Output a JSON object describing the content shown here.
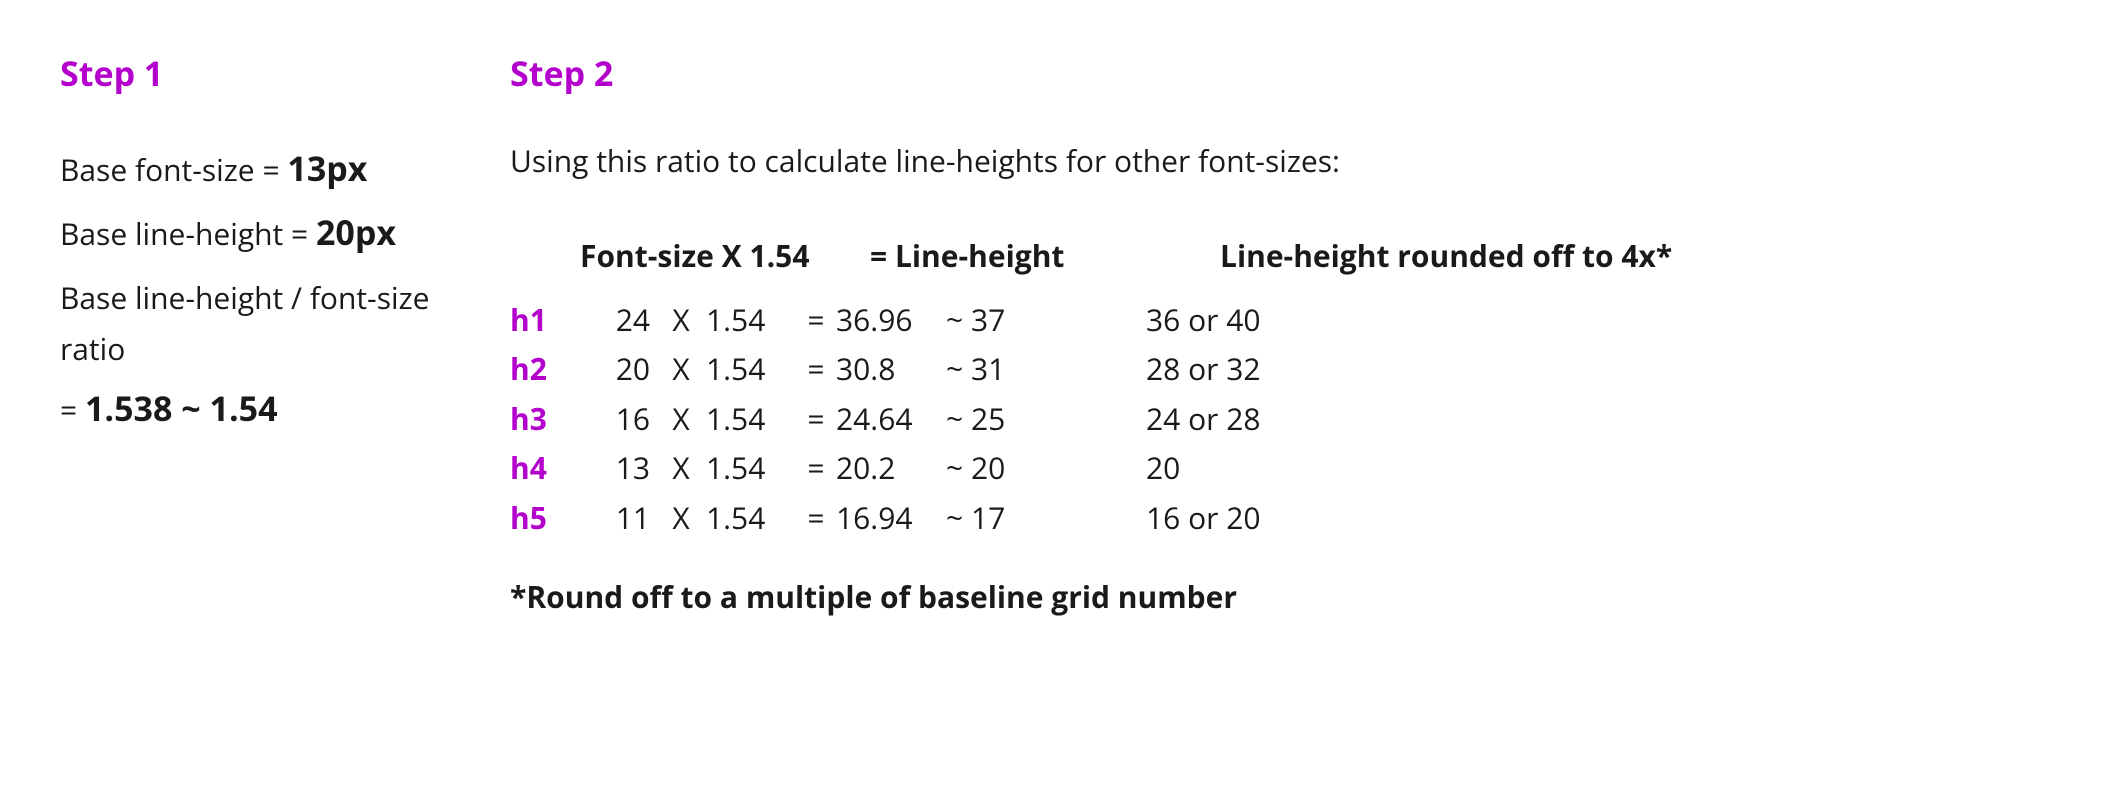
{
  "step1": {
    "title": "Step 1",
    "base_font_label": "Base font-size = ",
    "base_font_value": "13px",
    "base_lh_label": "Base line-height = ",
    "base_lh_value": "20px",
    "ratio_label": "Base line-height / font-size ratio",
    "ratio_value_prefix": "= ",
    "ratio_value": "1.538 ~ 1.54"
  },
  "step2": {
    "title": "Step 2",
    "description": "Using this ratio to calculate line-heights for other font-sizes:",
    "header": {
      "fontsize": "Font-size   X  1.54",
      "lineheight": "= Line-height",
      "rounded": "Line-height rounded off to 4x*"
    },
    "multiplier_sym": "X",
    "multiplier_val": "1.54",
    "equals": "=",
    "rows": [
      {
        "tag": "h1",
        "fs": "24",
        "product": "36.96",
        "approx": "~ 37",
        "rounded": "36 or 40"
      },
      {
        "tag": "h2",
        "fs": "20",
        "product": "30.8",
        "approx": "~ 31",
        "rounded": "28 or 32"
      },
      {
        "tag": "h3",
        "fs": "16",
        "product": "24.64",
        "approx": "~ 25",
        "rounded": "24 or 28"
      },
      {
        "tag": "h4",
        "fs": "13",
        "product": "20.2",
        "approx": "~ 20",
        "rounded": "20"
      },
      {
        "tag": "h5",
        "fs": "11",
        "product": "16.94",
        "approx": "~ 17",
        "rounded": "16 or 20"
      }
    ],
    "footnote": "*Round off to a multiple of baseline grid number"
  }
}
